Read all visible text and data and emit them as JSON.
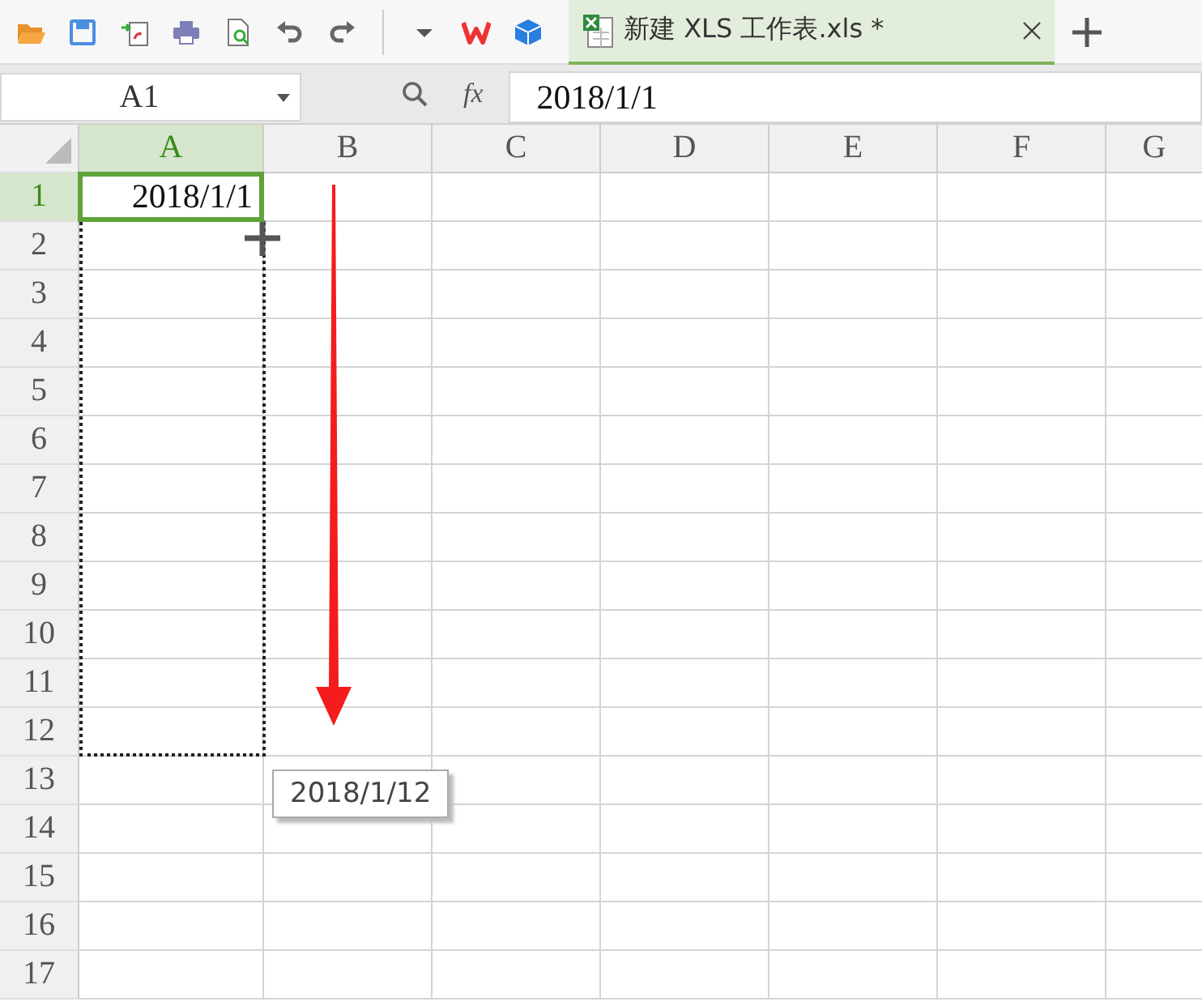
{
  "tab": {
    "title": "新建 XLS 工作表.xls *",
    "selected": true
  },
  "formula_bar": {
    "name_box": "A1",
    "fx_label": "fx",
    "value": "2018/1/1"
  },
  "sheet": {
    "columns": [
      {
        "label": "A",
        "selected": true
      },
      {
        "label": "B",
        "selected": false
      },
      {
        "label": "C",
        "selected": false
      },
      {
        "label": "D",
        "selected": false
      },
      {
        "label": "E",
        "selected": false
      },
      {
        "label": "F",
        "selected": false
      },
      {
        "label": "G",
        "selected": false
      }
    ],
    "rows": [
      {
        "label": "1",
        "selected": true,
        "cells": [
          "2018/1/1"
        ]
      },
      {
        "label": "2",
        "selected": false,
        "cells": []
      },
      {
        "label": "3",
        "selected": false,
        "cells": []
      },
      {
        "label": "4",
        "selected": false,
        "cells": []
      },
      {
        "label": "5",
        "selected": false,
        "cells": []
      },
      {
        "label": "6",
        "selected": false,
        "cells": []
      },
      {
        "label": "7",
        "selected": false,
        "cells": []
      },
      {
        "label": "8",
        "selected": false,
        "cells": []
      },
      {
        "label": "9",
        "selected": false,
        "cells": []
      },
      {
        "label": "10",
        "selected": false,
        "cells": []
      },
      {
        "label": "11",
        "selected": false,
        "cells": []
      },
      {
        "label": "12",
        "selected": false,
        "cells": []
      },
      {
        "label": "13",
        "selected": false,
        "cells": []
      },
      {
        "label": "14",
        "selected": false,
        "cells": []
      },
      {
        "label": "15",
        "selected": false,
        "cells": []
      },
      {
        "label": "16",
        "selected": false,
        "cells": []
      },
      {
        "label": "17",
        "selected": false,
        "cells": []
      }
    ],
    "fill_tooltip": "2018/1/12"
  }
}
